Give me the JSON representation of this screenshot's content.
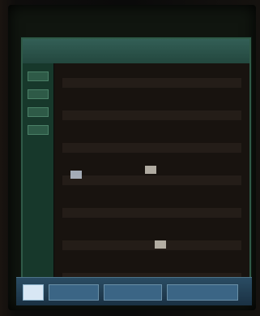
{
  "window": {
    "title": ""
  },
  "sidebar": {
    "buttons": [
      "",
      "",
      "",
      ""
    ]
  },
  "content": {
    "rows": [
      "",
      "",
      "",
      "",
      "",
      "",
      ""
    ]
  },
  "taskbar": {
    "items": [
      "",
      "",
      ""
    ]
  }
}
